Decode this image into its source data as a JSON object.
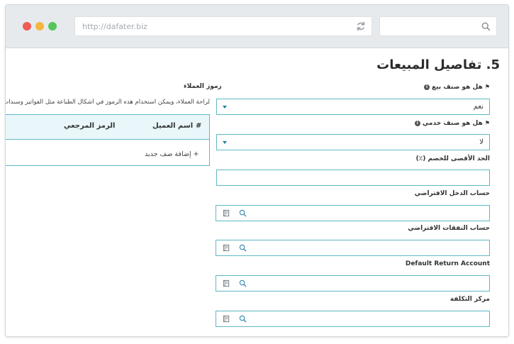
{
  "browser": {
    "url": "http://dafater.biz"
  },
  "section": {
    "title": "5. تفاصيل المبيعات"
  },
  "fields": {
    "is_sales_item": {
      "label": "هل هو صنف بيع",
      "value": "نعم"
    },
    "is_service_item": {
      "label": "هل هو صنف خدمي",
      "value": "لا"
    },
    "max_discount": {
      "label": "الحد الأقصى للخصم (٪)",
      "value": ""
    },
    "default_income_account": {
      "label": "حساب الدخل الافتراضي",
      "value": ""
    },
    "default_expense_account": {
      "label": "حساب النفقات الافتراضي",
      "value": ""
    },
    "default_return_account": {
      "label": "Default Return Account",
      "value": ""
    },
    "cost_center": {
      "label": "مركز التكلفة",
      "value": ""
    }
  },
  "customer_codes": {
    "title": "رموز العملاء",
    "description": "لراحة العملاء، ويمكن استخدام هذه الرموز في أشكال الطباعة مثل الفواتير وسندات",
    "columns": {
      "hash": "#",
      "customer_name": "اسم العميل",
      "ref_code": "الرمز المرجعي"
    },
    "add_row": "+ إضافة صف جديد"
  },
  "colors": {
    "accent_border": "#5fb8c4",
    "header_bg": "#e9f6fa",
    "caret": "#1d7fa0"
  },
  "icons": {
    "flag": "flag-icon",
    "info": "info-icon",
    "book": "book-icon",
    "search": "search-icon",
    "reload": "reload-icon"
  }
}
